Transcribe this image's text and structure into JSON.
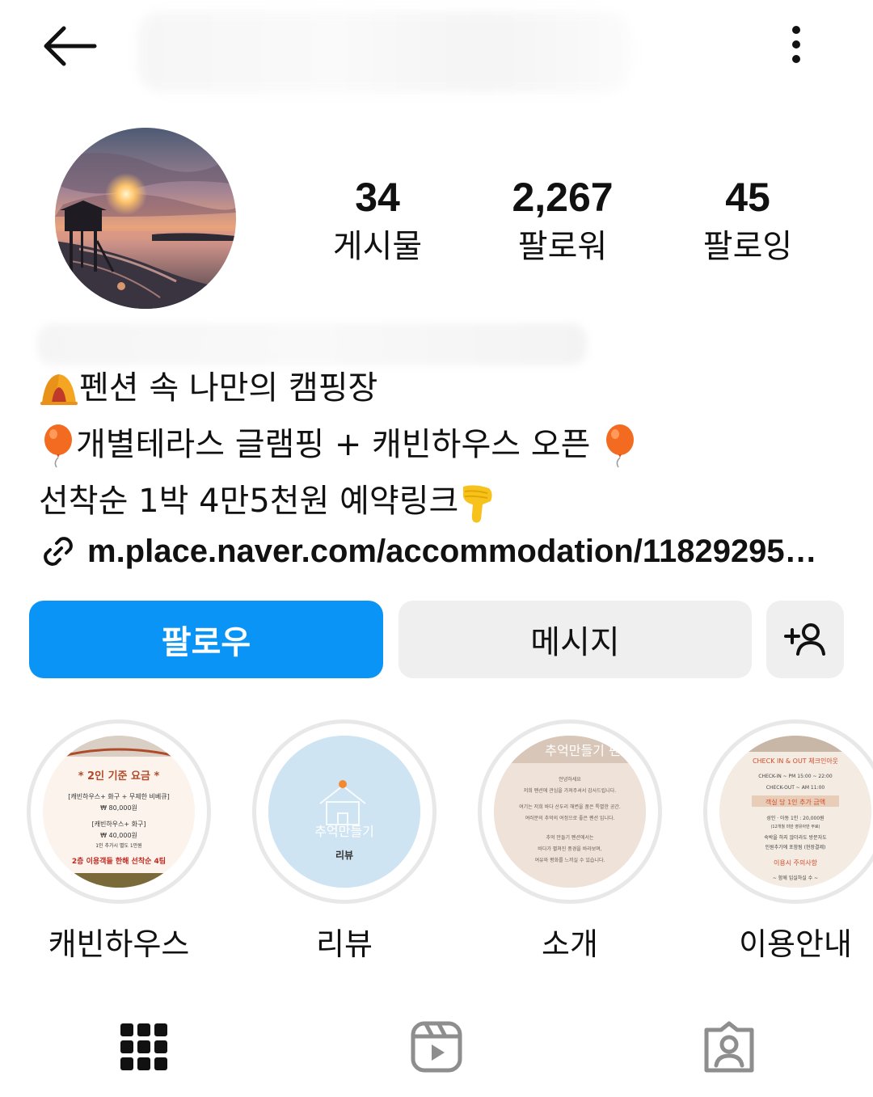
{
  "header": {
    "back_icon": "arrow-left-icon",
    "more_icon": "more-vertical-icon"
  },
  "stats": [
    {
      "value": "34",
      "label": "게시물"
    },
    {
      "value": "2,267",
      "label": "팔로워"
    },
    {
      "value": "45",
      "label": "팔로잉"
    }
  ],
  "bio": {
    "line1": "펜션 속 나만의 캠핑장",
    "line2": "개별테라스 글램핑 +  캐빈하우스 오픈",
    "line3": "선착순 1박 4만5천원 예약링크",
    "link": "m.place.naver.com/accommodation/11829295…"
  },
  "actions": {
    "follow_label": "팔로우",
    "message_label": "메시지",
    "add_user_icon": "add-user-icon"
  },
  "highlights": [
    {
      "label": "캐빈하우스",
      "cover": {
        "heading": "* 2인 기준 요금 *",
        "line1": "[캐빈하우스+ 화구 + 무제한 비베큐]",
        "price1": "₩ 80,000원",
        "line2": "[캐빈하우스+ 화구]",
        "price2": "₩ 40,000원",
        "note": "1인 추가시 별도 1만원",
        "footer": "2층 이용객들 한해 선착순 4팀"
      }
    },
    {
      "label": "리뷰",
      "cover": {
        "title": "추억만들기",
        "subtitle": "리뷰"
      }
    },
    {
      "label": "소개",
      "cover": {
        "title": "추억만들기 펜",
        "line1": "안녕하세요",
        "line2": "저희 펜션에 관심을 가져주셔서 감사드립니다.",
        "line3": "여기는 저희 바다 산두리 해변을 품은 특별한 공간.",
        "line4": "여러분의 추억의 여정으로 좋은 펜션 입니다.",
        "line5": "추억 만들기 펜션에서는",
        "line6": "바다가 펼쳐진 풍경을 바라보며,",
        "line7": "여유와 평화를 느끼실 수 있습니다."
      }
    },
    {
      "label": "이용안내",
      "cover": {
        "heading": "CHECK IN & OUT 체크인아웃",
        "line1": "CHECK-IN ~ PM 15:00 ~ 22:00",
        "line2": "CHECK-OUT ~ AM 11:00",
        "heading2": "객실 당 1인 추가 금액",
        "line3": "성인 · 아동 1인 : 20,000원",
        "line4": "(12개월 미만 영유아만 무료)",
        "line5": "숙박을 하지 않더라도 방문자도",
        "line6": "인원추가에 포함됨 (현장결제)",
        "heading3": "이용시 주의사항",
        "line7": "~ 함께 입실하실 수 ~"
      }
    }
  ],
  "tabs": [
    {
      "icon": "grid-icon"
    },
    {
      "icon": "reels-icon"
    },
    {
      "icon": "tagged-icon"
    }
  ],
  "colors": {
    "follow_button": "#0a95f6",
    "secondary_button": "#efefef"
  }
}
